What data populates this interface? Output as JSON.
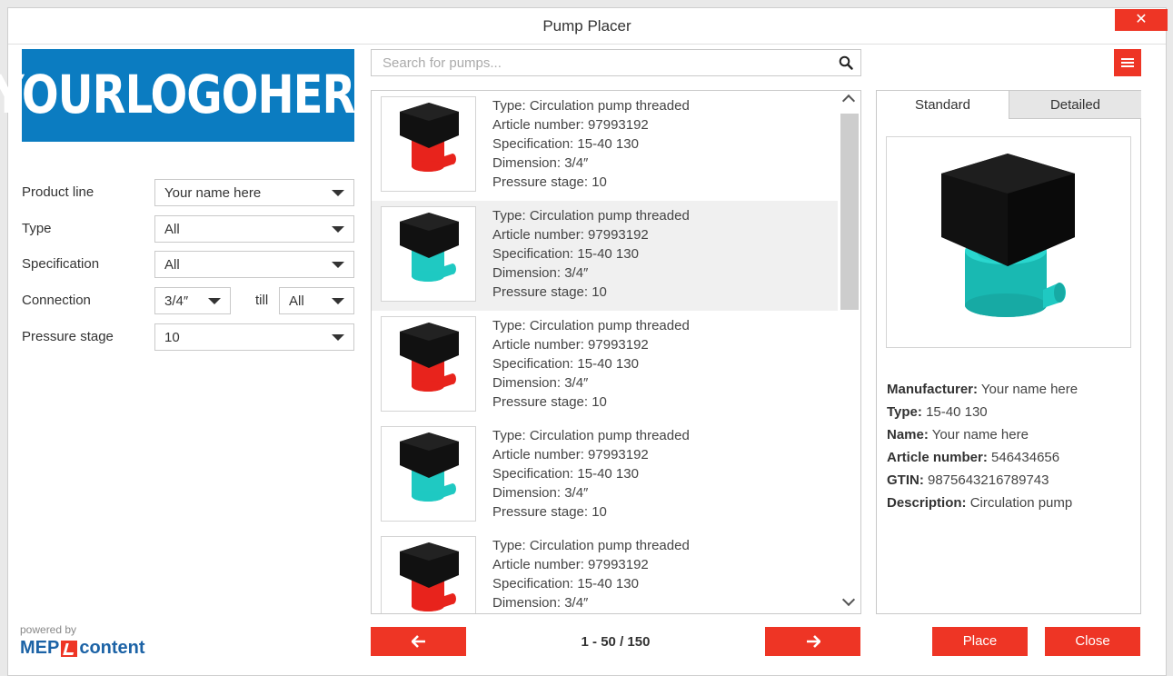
{
  "window": {
    "title": "Pump Placer",
    "close_glyph": "✕"
  },
  "logo": {
    "text": "YOURLOGOHERE",
    "color": "#0b7cc1"
  },
  "filters": {
    "product_line": {
      "label": "Product line",
      "value": "Your name here"
    },
    "type": {
      "label": "Type",
      "value": "All"
    },
    "specification": {
      "label": "Specification",
      "value": "All"
    },
    "connection": {
      "label": "Connection",
      "value": "3/4″",
      "till_label": "till",
      "till_value": "All"
    },
    "pressure_stage": {
      "label": "Pressure stage",
      "value": "10"
    }
  },
  "footer_brand": {
    "powered_by": "powered by",
    "left": "MEP",
    "right": "content"
  },
  "search": {
    "placeholder": "Search for pumps..."
  },
  "results": [
    {
      "color": "red",
      "selected": false,
      "type": "Type: Circulation pump threaded",
      "article": "Article number: 97993192",
      "spec": "Specification: 15-40 130",
      "dimension": "Dimension: 3/4″",
      "pressure": "Pressure stage: 10"
    },
    {
      "color": "cyan",
      "selected": true,
      "type": "Type: Circulation pump threaded",
      "article": "Article number: 97993192",
      "spec": "Specification: 15-40 130",
      "dimension": "Dimension: 3/4″",
      "pressure": "Pressure stage: 10"
    },
    {
      "color": "red",
      "selected": false,
      "type": "Type: Circulation pump threaded",
      "article": "Article number: 97993192",
      "spec": "Specification: 15-40 130",
      "dimension": "Dimension: 3/4″",
      "pressure": "Pressure stage: 10"
    },
    {
      "color": "cyan",
      "selected": false,
      "type": "Type: Circulation pump threaded",
      "article": "Article number: 97993192",
      "spec": "Specification: 15-40 130",
      "dimension": "Dimension: 3/4″",
      "pressure": "Pressure stage: 10"
    },
    {
      "color": "red",
      "selected": false,
      "type": "Type: Circulation pump threaded",
      "article": "Article number: 97993192",
      "spec": "Specification: 15-40 130",
      "dimension": "Dimension: 3/4″",
      "pressure": ""
    }
  ],
  "pagination": {
    "label": "1 - 50 / 150",
    "prev_icon": "arrow-left-icon",
    "next_icon": "arrow-right-icon"
  },
  "detail": {
    "tabs": {
      "standard": "Standard",
      "detailed": "Detailed"
    },
    "props": {
      "manufacturer_label": "Manufacturer:",
      "manufacturer": "Your name here",
      "type_label": "Type:",
      "type": "15-40 130",
      "name_label": "Name:",
      "name": "Your name here",
      "article_label": "Article number:",
      "article": "546434656",
      "gtin_label": "GTIN:",
      "gtin": "9875643216789743",
      "description_label": "Description:",
      "description": "Circulation pump"
    }
  },
  "actions": {
    "place": "Place",
    "close": "Close"
  },
  "colors": {
    "accent": "#ee3525",
    "pump_red": "#e8231c",
    "pump_cyan": "#1fc9c2",
    "motor": "#111111"
  }
}
